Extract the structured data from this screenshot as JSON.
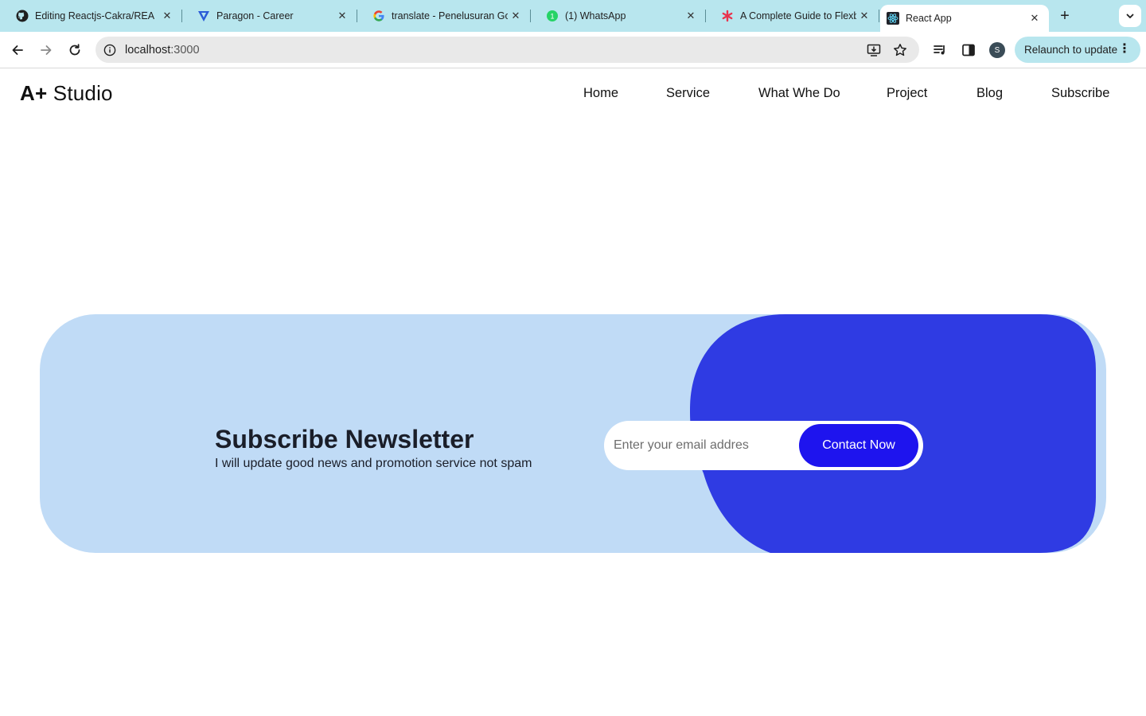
{
  "browser": {
    "tabs": [
      {
        "title": "Editing Reactjs-Cakra/REA",
        "favicon": "github-icon"
      },
      {
        "title": "Paragon - Career",
        "favicon": "paragon-icon"
      },
      {
        "title": "translate - Penelusuran Go",
        "favicon": "google-icon"
      },
      {
        "title": "(1) WhatsApp",
        "favicon": "whatsapp-icon"
      },
      {
        "title": "A Complete Guide to Flexb",
        "favicon": "css-tricks-icon"
      },
      {
        "title": "React App",
        "favicon": "react-icon",
        "active": true
      }
    ],
    "url_host": "localhost",
    "url_port": ":3000",
    "profile_initial": "S",
    "relaunch_label": "Relaunch to update"
  },
  "site": {
    "logo_mark": "A+",
    "logo_text": " Studio",
    "nav": [
      "Home",
      "Service",
      "What Whe Do",
      "Project",
      "Blog",
      "Subscribe"
    ]
  },
  "newsletter": {
    "title": "Subscribe Newsletter",
    "subtitle": "I will update good news and promotion service not spam",
    "email_placeholder": "Enter your email addres",
    "button_label": "Contact Now"
  },
  "colors": {
    "tabstrip": "#b8e6ee",
    "banner_bg": "#c0dbf6",
    "banner_blob": "#2f3be3",
    "button_bg": "#1e14ee"
  }
}
